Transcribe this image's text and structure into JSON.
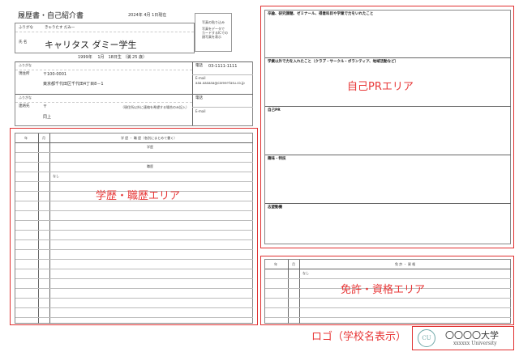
{
  "document": {
    "title": "履歴書・自己紹介書",
    "date_line": "2024年 4月 1日現在",
    "photo_note": [
      "写真の貼り込み",
      "写真をデータで",
      "カードするICでの",
      "顔写真を表示"
    ],
    "furigana_label": "ふりがな",
    "name_furigana": "きゃりたす だみー",
    "name_label": "氏 名",
    "name": "キャリタス ダミー学生",
    "birth_line": "1999年　 1月　18日生 （満 25 歳）",
    "address_furigana_label": "ふりがな",
    "current_address_label": "現住所",
    "postal": "〒100-0001",
    "address": "東京都千代田区千代田4丁目8－1",
    "phone_label": "電話",
    "phone": "03-1111-1111",
    "email_label": "E-mail",
    "email": "aaa.aaaaaa@career-tasu.co.jp",
    "contact_furigana_label": "ふりがな",
    "contact_label": "連絡先",
    "contact_postal": "〒",
    "contact_note": "（現住所以外に連絡を希望する場合のみ記入）",
    "contact_same": "同上",
    "contact_phone_label": "電話",
    "contact_email_label": "E-mail"
  },
  "history": {
    "col_year": "年",
    "col_month": "月",
    "col_content": "学 歴 ・ 職 歴（各別にまとめて書く）",
    "education_heading": "学歴",
    "work_heading": "職歴",
    "none_text": "なし"
  },
  "pr": {
    "q1": "卒論、研究課題、ゼミナール、得意科目や学業で力をいれたこと",
    "q2": "学業以外で力を入れたこと（クラブ・サークル・ボランティア、地域活動など）",
    "q3": "自己PR",
    "q4": "趣味・特技",
    "q5": "志望動機"
  },
  "license": {
    "col_year": "年",
    "col_month": "月",
    "col_content": "免 許 ・ 資 格",
    "none_text": "なし"
  },
  "areas": {
    "pr_area": "自己PRエリア",
    "history_area": "学歴・職歴エリア",
    "license_area": "免許・資格エリア",
    "logo_area": "ロゴ（学校名表示）"
  },
  "logo": {
    "emblem": "CU",
    "name": "〇〇〇〇大学",
    "sub": "xxxxxx University"
  },
  "colors": {
    "area_red": "#e03030",
    "logo_teal": "#6fa8a8"
  }
}
